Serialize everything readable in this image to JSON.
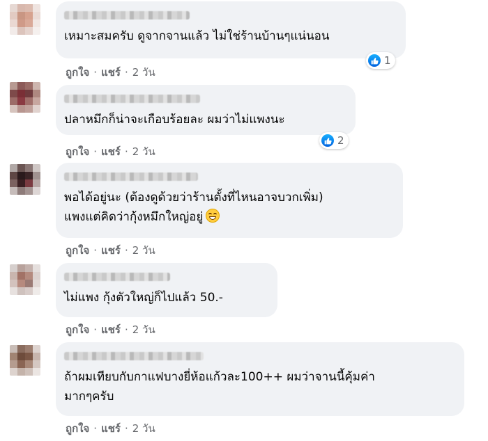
{
  "comments": [
    {
      "text_lines": [
        "เหมาะสมครับ ดูจากจานแล้ว ไม่ใช่ร้านบ้านๆแน่นอน"
      ],
      "reaction_count": "1",
      "actions": {
        "like": "ถูกใจ",
        "reply": "แชร์",
        "time": "2 วัน"
      }
    },
    {
      "text_lines": [
        "ปลาหมึกก็น่าจะเกือบร้อยละ ผมว่าไม่แพงนะ"
      ],
      "reaction_count": "2",
      "actions": {
        "like": "ถูกใจ",
        "reply": "แชร์",
        "time": "2 วัน"
      }
    },
    {
      "text_lines": [
        "พอได้อยู่นะ (ต้องดูด้วยว่าร้านตั้งที่ไหนอาจบวกเพิ่ม)",
        "แพงแต่คิดว่ากุ้งหมึกใหญ่อยู่"
      ],
      "emoji": "grinning-face",
      "actions": {
        "like": "ถูกใจ",
        "reply": "แชร์",
        "time": "2 วัน"
      }
    },
    {
      "text_lines": [
        "ไม่แพง กุ้งตัวใหญ่ก็ไปแล้ว 50.-"
      ],
      "actions": {
        "like": "ถูกใจ",
        "reply": "แชร์",
        "time": "2 วัน"
      }
    },
    {
      "text_lines": [
        "ถ้าผมเทียบกับกาแฟบางยี่ห้อแก้วละ100++ ผมว่าจานนี้คุ้มค่า",
        "มากๆครับ"
      ],
      "actions": {
        "like": "ถูกใจ",
        "reply": "แชร์",
        "time": "2 วัน"
      }
    }
  ],
  "icons": {
    "reaction": "like-thumb-icon"
  },
  "colors": {
    "bubble": "#f0f2f5",
    "meta_text": "#65676b",
    "like_blue": "#1877f2"
  }
}
